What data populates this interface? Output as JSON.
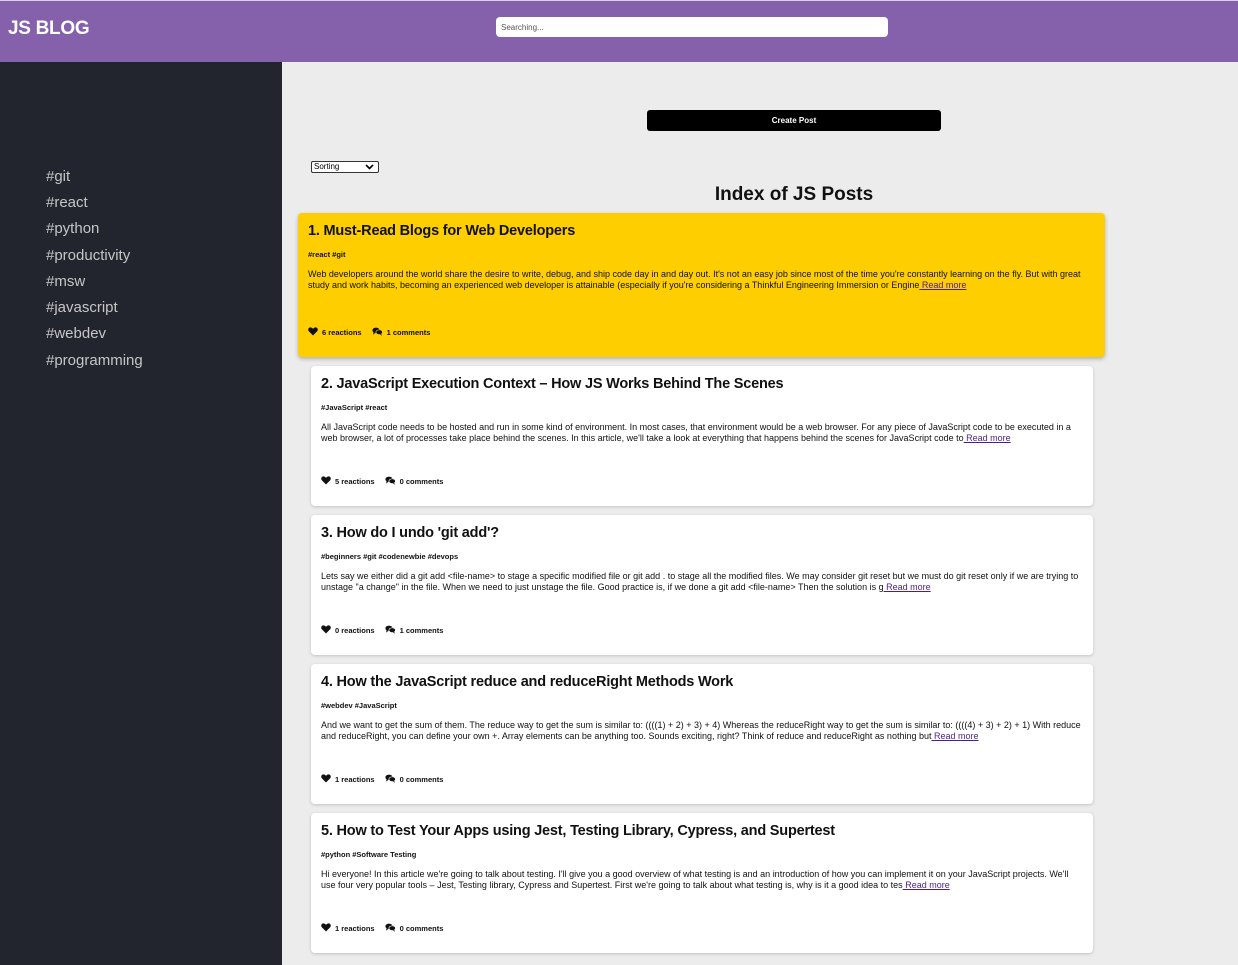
{
  "header": {
    "logo": "JS BLOG",
    "search_placeholder": "Searching..."
  },
  "sidebar": {
    "tags": [
      "#git",
      "#react",
      "#python",
      "#productivity",
      "#msw",
      "#javascript",
      "#webdev",
      "#programming"
    ]
  },
  "main": {
    "create_label": "Create Post",
    "sort_value": "Sorting",
    "index_title": "Index of JS Posts"
  },
  "posts": [
    {
      "title": "1. Must-Read Blogs for Web Developers",
      "tags": "#react #git",
      "excerpt": "Web developers around the world share the desire to write, debug, and ship code day in and day out. It's not an easy job since most of the time you're constantly learning on the fly. But with great study and work habits, becoming an experienced web developer is attainable (especially if you're considering a Thinkful Engineering Immersion or Engine",
      "read_more": " Read more",
      "reactions": "6 reactions",
      "comments": "1 comments",
      "highlighted": true
    },
    {
      "title": "2. JavaScript Execution Context – How JS Works Behind The Scenes",
      "tags": "#JavaScript #react",
      "excerpt": "All JavaScript code needs to be hosted and run in some kind of environment. In most cases, that environment would be a web browser. For any piece of JavaScript code to be executed in a web browser, a lot of processes take place behind the scenes. In this article, we'll take a look at everything that happens behind the scenes for JavaScript code to",
      "read_more": " Read more",
      "reactions": "5 reactions",
      "comments": "0 comments",
      "highlighted": false
    },
    {
      "title": "3. How do I undo 'git add'?",
      "tags": "#beginners #git #codenewbie #devops",
      "excerpt": "Lets say we either did a git add <file-name> to stage a specific modified file or git add . to stage all the modified files. We may consider git reset but we must do git reset only if we are trying to unstage \"a change\" in the file. When we need to just unstage the file. Good practice is, if we done a git add <file-name> Then the solution is g",
      "read_more": " Read more",
      "reactions": "0 reactions",
      "comments": "1 comments",
      "highlighted": false
    },
    {
      "title": "4. How the JavaScript reduce and reduceRight Methods Work",
      "tags": "#webdev #JavaScript",
      "excerpt": "And we want to get the sum of them. The reduce way to get the sum is similar to: ((((1) + 2) + 3) + 4) Whereas the reduceRight way to get the sum is similar to: ((((4) + 3) + 2) + 1) With reduce and reduceRight, you can define your own +. Array elements can be anything too. Sounds exciting, right? Think of reduce and reduceRight as nothing but",
      "read_more": " Read more",
      "reactions": "1 reactions",
      "comments": "0 comments",
      "highlighted": false
    },
    {
      "title": "5. How to Test Your Apps using Jest, Testing Library, Cypress, and Supertest",
      "tags": "#python #Software Testing",
      "excerpt": "Hi everyone! In this article we're going to talk about testing. I'll give you a good overview of what testing is and an introduction of how you can implement it on your JavaScript projects. We'll use four very popular tools – Jest, Testing library, Cypress and Supertest. First we're going to talk about what testing is, why is it a good idea to tes",
      "read_more": " Read more",
      "reactions": "1 reactions",
      "comments": "0 comments",
      "highlighted": false
    }
  ]
}
